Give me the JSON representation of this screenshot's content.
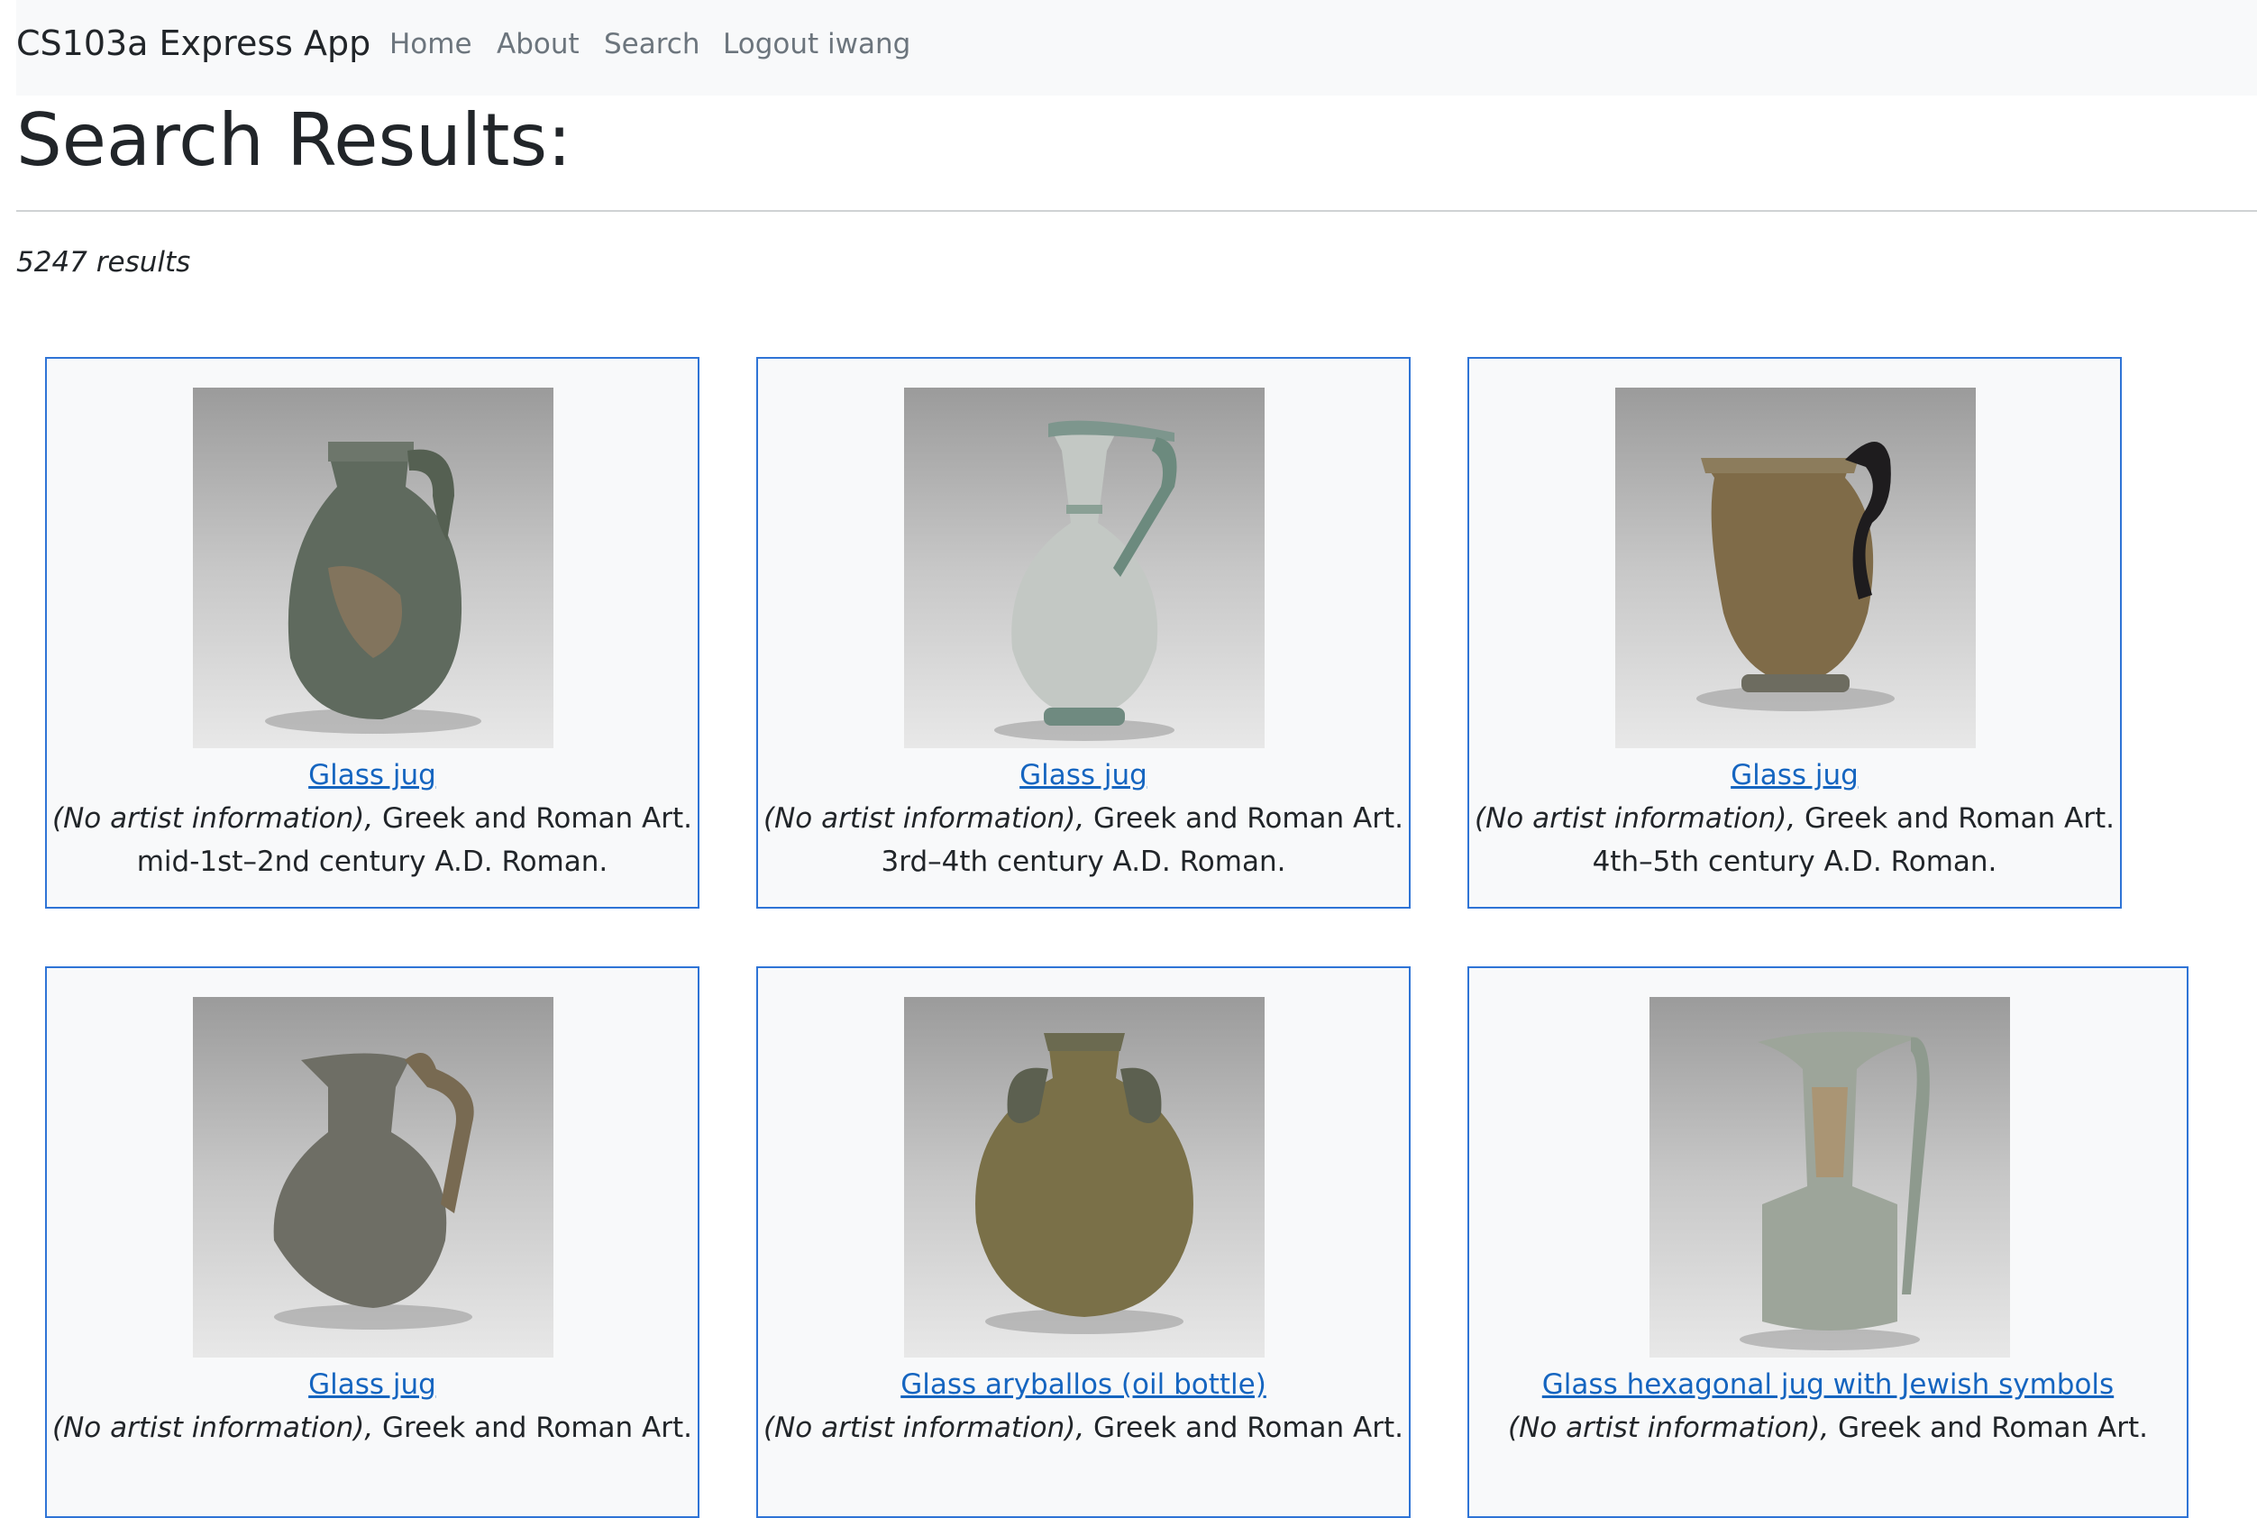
{
  "navbar": {
    "brand": "CS103a Express App",
    "links": [
      "Home",
      "About",
      "Search",
      "Logout iwang"
    ]
  },
  "page": {
    "title": "Search Results:",
    "count": "5247 results"
  },
  "results": [
    {
      "title": "Glass jug",
      "artist": "(No artist information),",
      "dept": "Greek and Roman Art.",
      "date": "mid-1st–2nd century A.D. Roman."
    },
    {
      "title": "Glass jug",
      "artist": "(No artist information),",
      "dept": "Greek and Roman Art.",
      "date": "3rd–4th century A.D. Roman."
    },
    {
      "title": "Glass jug",
      "artist": "(No artist information),",
      "dept": "Greek and Roman Art.",
      "date": "4th–5th century A.D. Roman."
    },
    {
      "title": "Glass jug",
      "artist": "(No artist information),",
      "dept": "Greek and Roman Art.",
      "date": ""
    },
    {
      "title": "Glass aryballos (oil bottle)",
      "artist": "(No artist information),",
      "dept": "Greek and Roman Art.",
      "date": ""
    },
    {
      "title": "Glass hexagonal jug with Jewish symbols",
      "artist": "(No artist information),",
      "dept": "Greek and Roman Art.",
      "date": ""
    }
  ],
  "colors": {
    "link": "#1565c0",
    "card_border": "#2f74d6",
    "navbar_bg": "#f8f9fa"
  }
}
